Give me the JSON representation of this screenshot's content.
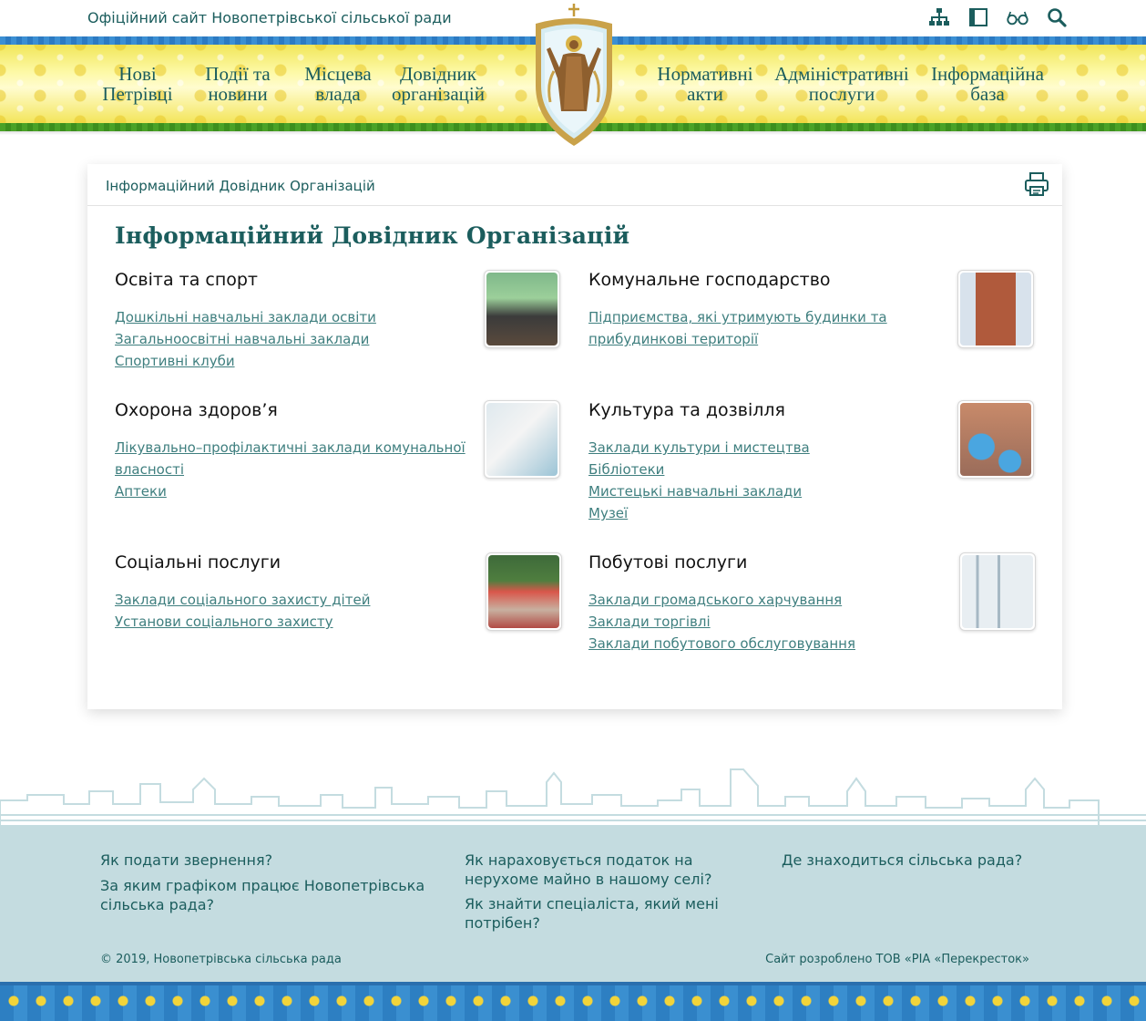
{
  "site": {
    "title": "Офіційний сайт Новопетрівської сільської ради"
  },
  "top_icons": [
    "sitemap-icon",
    "layout-icon",
    "glasses-icon",
    "search-icon"
  ],
  "nav": {
    "left": [
      {
        "line1": "Нові",
        "line2": "Петрівці"
      },
      {
        "line1": "Події та",
        "line2": "новини"
      },
      {
        "line1": "Місцева",
        "line2": "влада"
      },
      {
        "line1": "Довідник",
        "line2": "організацій"
      }
    ],
    "right": [
      {
        "line1": "Нормативні",
        "line2": "акти"
      },
      {
        "line1": "Адміністративні",
        "line2": "послуги"
      },
      {
        "line1": "Інформаційна",
        "line2": "база"
      }
    ]
  },
  "breadcrumb": "Інформаційний Довідник Організацій",
  "page_title": "Інформаційний Довідник Організацій",
  "sections": [
    {
      "title": "Освіта та спорт",
      "links": [
        "Дошкільні навчальні заклади освіти",
        "Загальноосвітні навчальні заклади",
        "Спортивні клуби"
      ]
    },
    {
      "title": "Комунальне господарство",
      "links": [
        "Підприємства, які утримують будинки та прибудинкові території"
      ]
    },
    {
      "title": "Охорона здоров’я",
      "links": [
        "Лікувально–профілактичні заклади комунальної власності",
        "Аптеки"
      ]
    },
    {
      "title": "Культура та дозвілля",
      "links": [
        "Заклади культури і мистецтва",
        "Бібліотеки",
        "Мистецькі навчальні заклади",
        "Музеї"
      ]
    },
    {
      "title": "Соціальні послуги",
      "links": [
        "Заклади соціального захисту дітей",
        "Установи соціального захисту"
      ]
    },
    {
      "title": "Побутові послуги",
      "links": [
        "Заклади громадського харчування",
        "Заклади торгівлі",
        "Заклади побутового обслуговування"
      ]
    }
  ],
  "footer": {
    "faq": [
      "Як подати звернення?",
      "За яким графіком працює Новопетрівська сільська рада?",
      "Як нараховується податок на нерухоме майно в нашому селі?",
      "Як знайти спеціаліста, який мені потрібен?",
      "Де знаходиться сільська рада?"
    ],
    "copyright": "© 2019, Новопетрівська сільська рада",
    "developer": "Сайт розроблено ТОВ «РІА «Перекресток»"
  },
  "colors": {
    "accent": "#1b5d5d",
    "link": "#3f7f7f",
    "footer_bg": "#c4dce0",
    "band_yellow": "#f3e55a",
    "band_blue": "#2c7ac2",
    "band_green": "#4aa227"
  }
}
